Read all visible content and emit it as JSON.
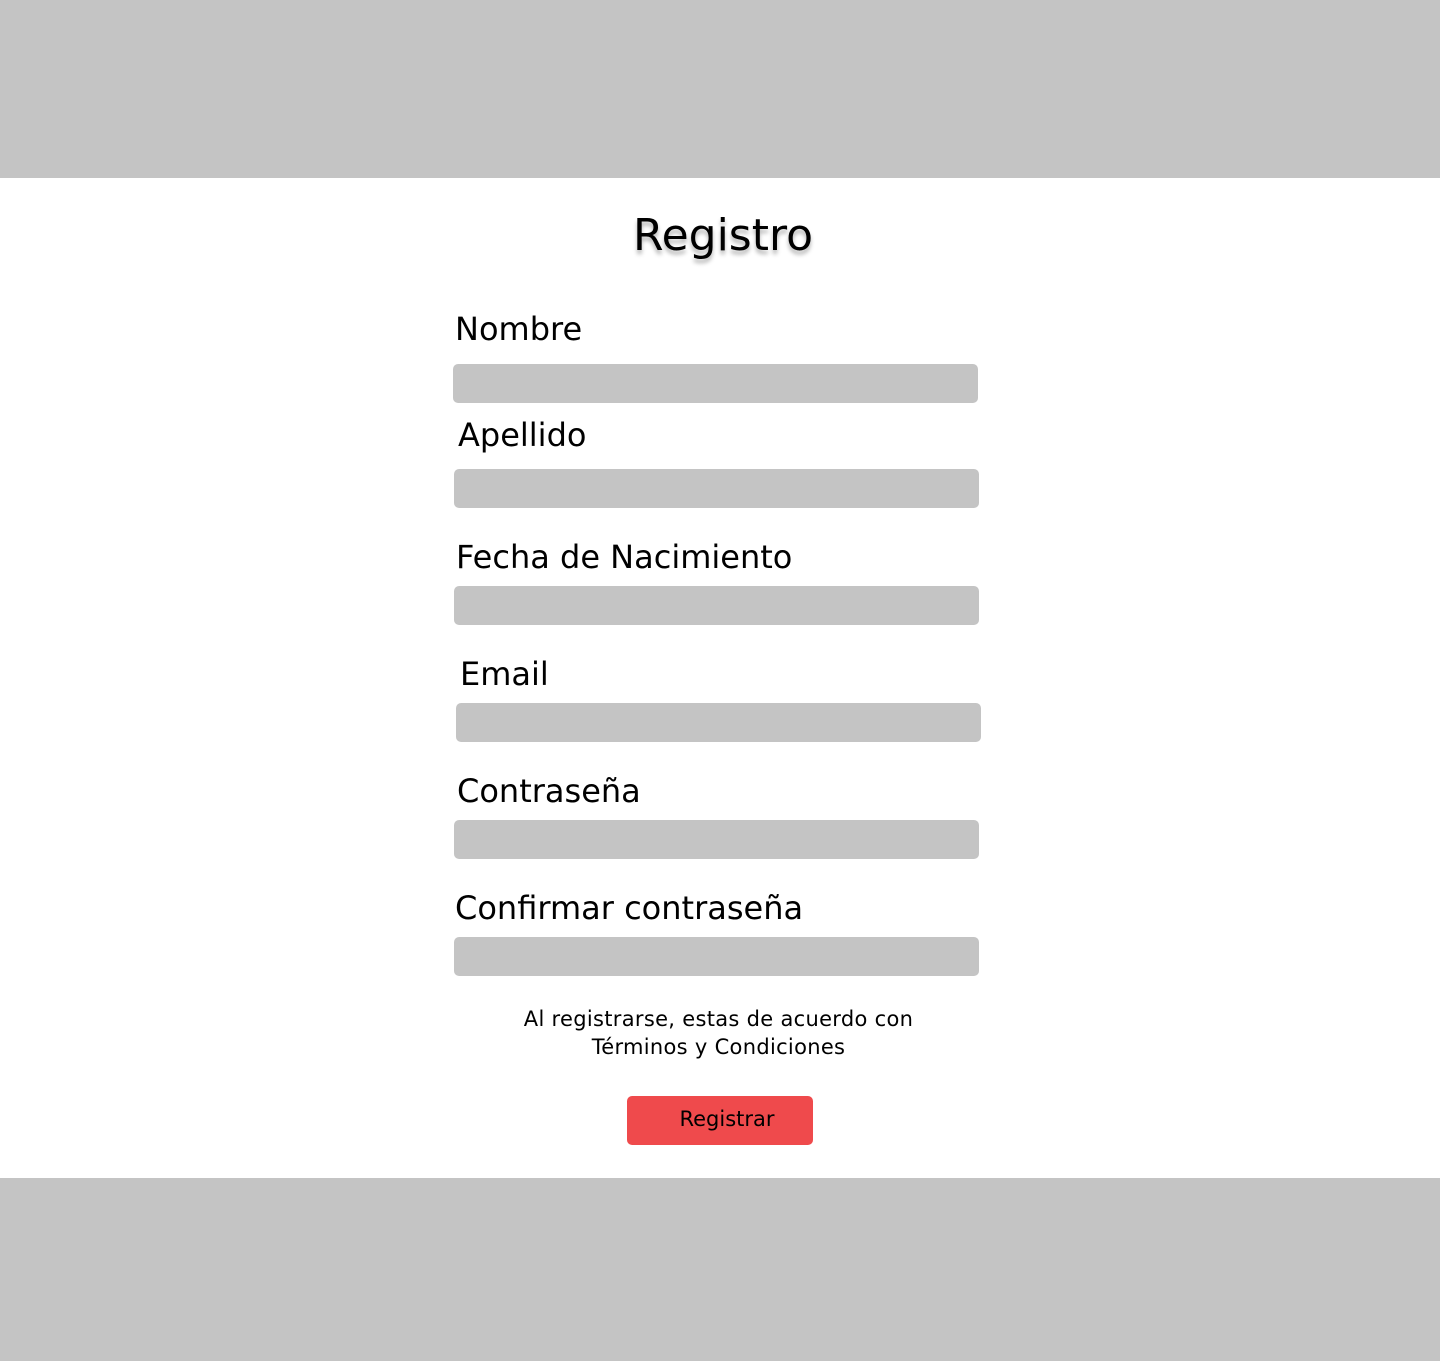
{
  "page": {
    "title": "Registro"
  },
  "form": {
    "fields": [
      {
        "label": "Nombre",
        "value": "",
        "placeholder": ""
      },
      {
        "label": "Apellido",
        "value": "",
        "placeholder": ""
      },
      {
        "label": "Fecha de Nacimiento",
        "value": "",
        "placeholder": ""
      },
      {
        "label": "Email",
        "value": "",
        "placeholder": ""
      },
      {
        "label": "Contraseña",
        "value": "",
        "placeholder": ""
      },
      {
        "label": "Confirmar contraseña",
        "value": "",
        "placeholder": ""
      }
    ],
    "terms_line_1": "Al registrarse, estas de acuerdo con",
    "terms_line_2": "Términos y Condiciones",
    "submit_label": "Registrar"
  },
  "colors": {
    "bars": "#c4c4c4",
    "input_background": "#c4c4c4",
    "button_background": "#ef4a4c",
    "background": "#ffffff",
    "text": "#000000"
  }
}
